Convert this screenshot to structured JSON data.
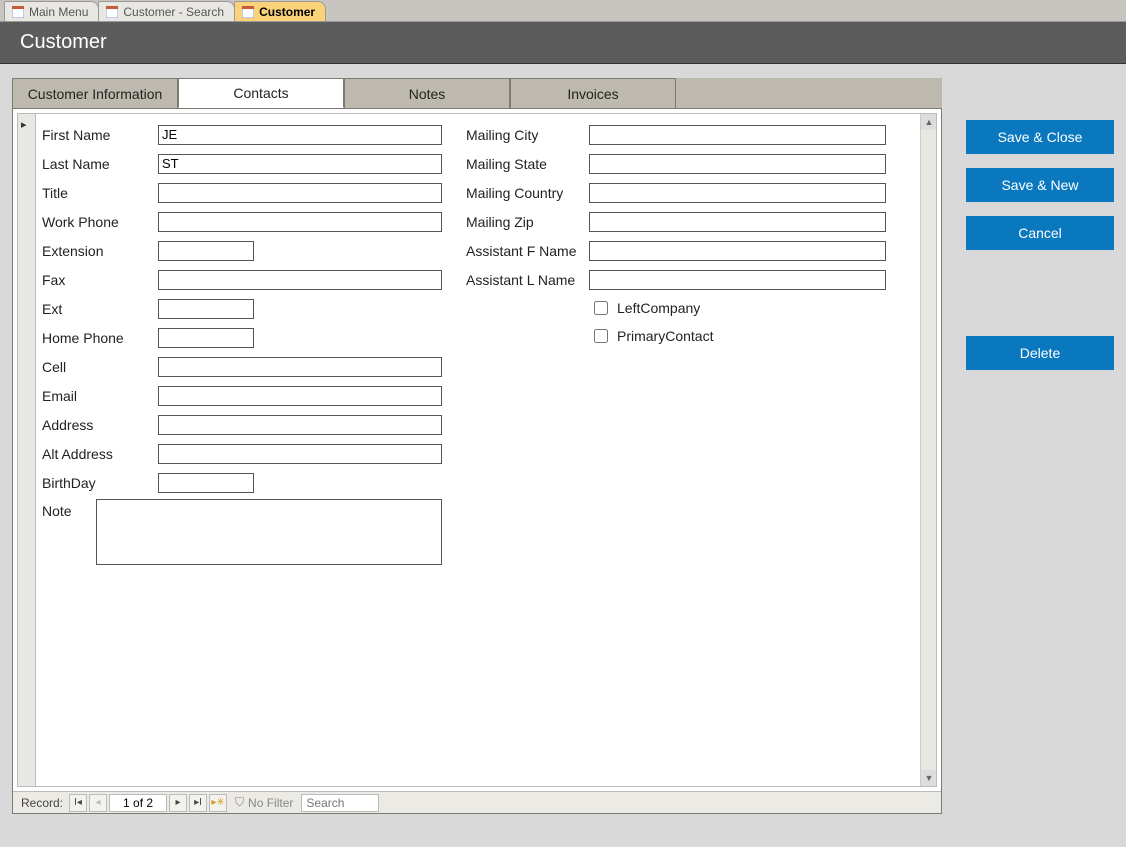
{
  "docTabs": [
    {
      "label": "Main Menu",
      "active": false
    },
    {
      "label": "Customer - Search",
      "active": false
    },
    {
      "label": "Customer",
      "active": true
    }
  ],
  "header": {
    "title": "Customer"
  },
  "innerTabs": [
    {
      "label": "Customer Information",
      "active": false
    },
    {
      "label": "Contacts",
      "active": true
    },
    {
      "label": "Notes",
      "active": false
    },
    {
      "label": "Invoices",
      "active": false
    }
  ],
  "contact": {
    "firstName": "JE",
    "lastName": "ST",
    "title": "",
    "workPhone": "",
    "extension": "",
    "fax": "",
    "ext": "",
    "homePhone": "",
    "cell": "",
    "email": "",
    "address": "",
    "altAddress": "",
    "birthday": "",
    "note": "",
    "mailingCity": "",
    "mailingState": "",
    "mailingCountry": "",
    "mailingZip": "",
    "assistantFName": "",
    "assistantLName": "",
    "leftCompany": false,
    "primaryContact": false
  },
  "labels": {
    "firstName": "First Name",
    "lastName": "Last Name",
    "title": "Title",
    "workPhone": "Work Phone",
    "extension": "Extension",
    "fax": "Fax",
    "ext": "Ext",
    "homePhone": "Home Phone",
    "cell": "Cell",
    "email": "Email",
    "address": "Address",
    "altAddress": "Alt Address",
    "birthday": "BirthDay",
    "note": "Note",
    "mailingCity": "Mailing City",
    "mailingState": "Mailing State",
    "mailingCountry": "Mailing Country",
    "mailingZip": "Mailing Zip",
    "assistantFName": "Assistant F Name",
    "assistantLName": "Assistant L Name",
    "leftCompany": "LeftCompany",
    "primaryContact": "PrimaryContact"
  },
  "nav": {
    "recordLabel": "Record:",
    "position": "1 of 2",
    "filter": "No Filter",
    "searchPlaceholder": "Search"
  },
  "actions": {
    "saveClose": "Save & Close",
    "saveNew": "Save & New",
    "cancel": "Cancel",
    "delete": "Delete"
  }
}
